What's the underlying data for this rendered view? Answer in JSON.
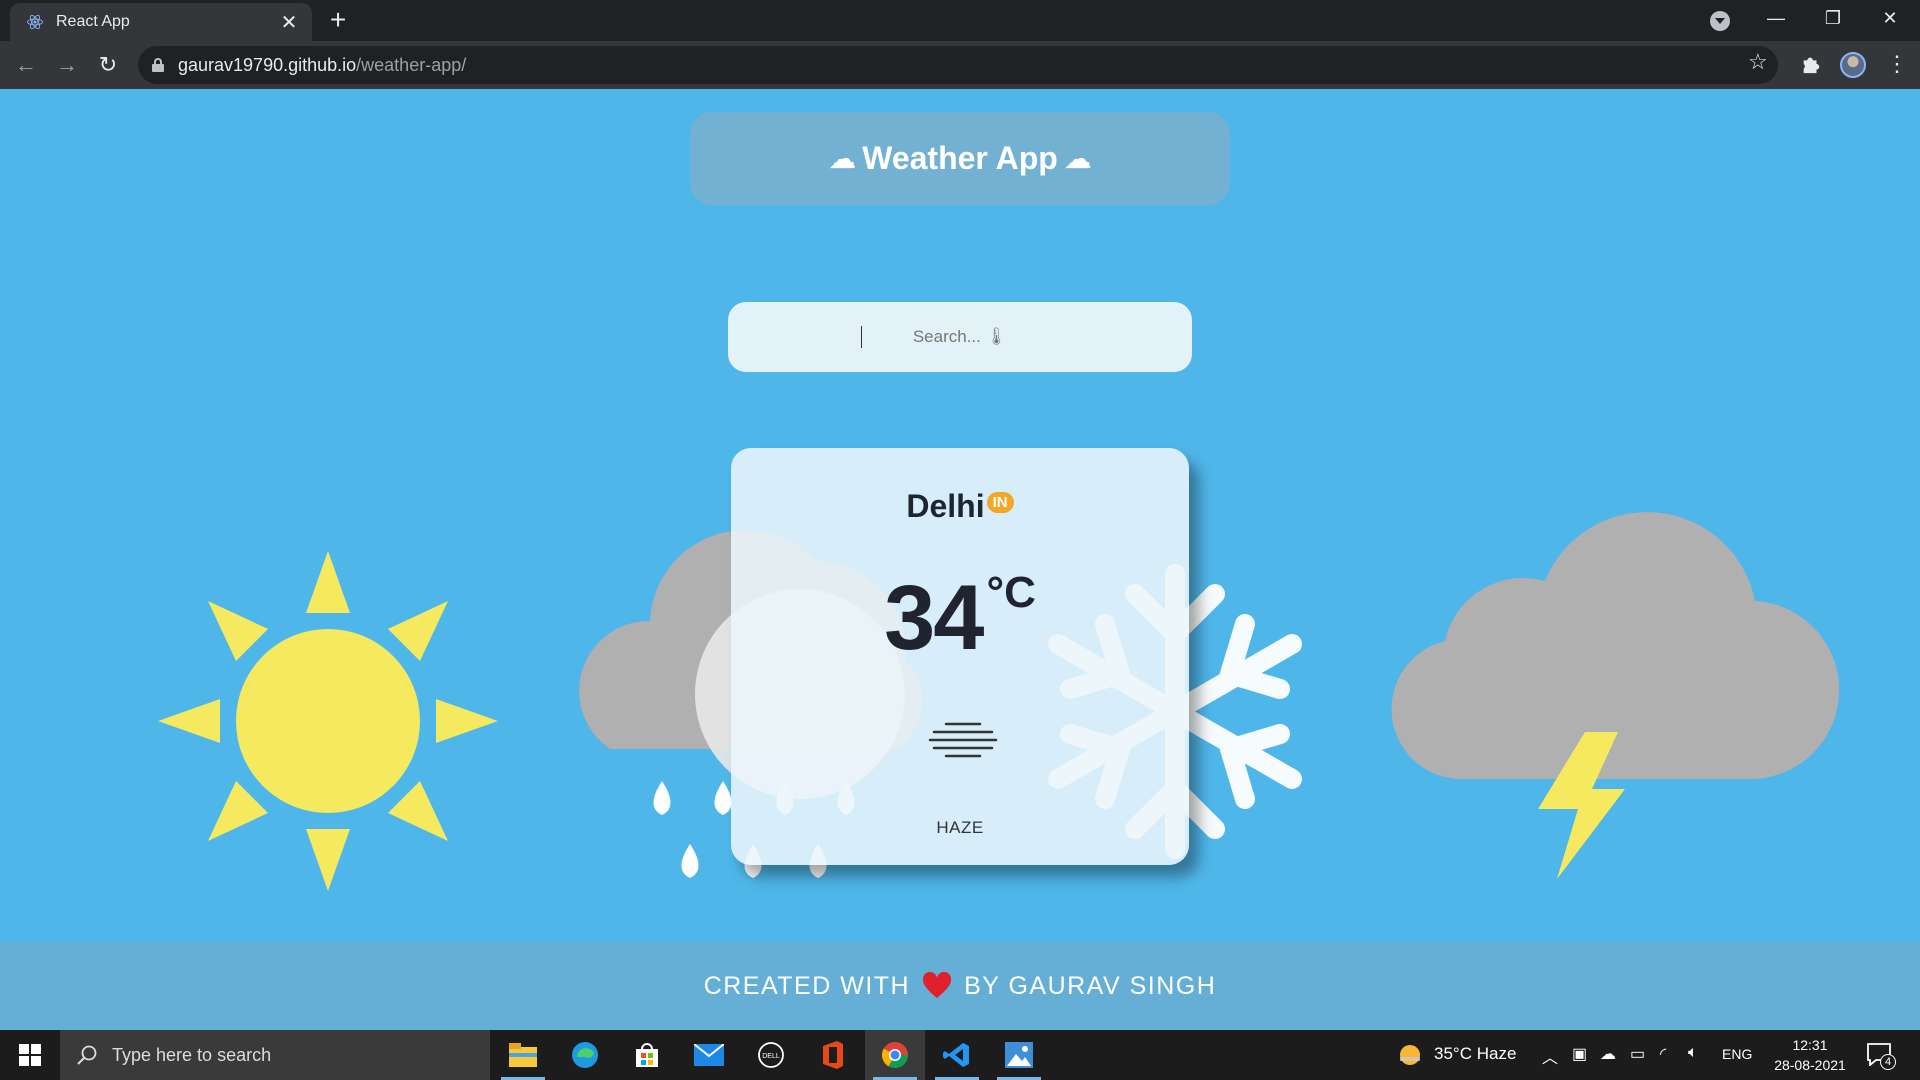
{
  "browser": {
    "tab_title": "React App",
    "url_host": "gaurav19790.github.io",
    "url_path": "/weather-app/",
    "icons": [
      "react-icon",
      "close-icon",
      "plus-icon",
      "back-icon",
      "forward-icon",
      "reload-icon",
      "lock-icon",
      "star-icon",
      "puzzle-icon",
      "menu-icon"
    ]
  },
  "app": {
    "title": "Weather App",
    "search_placeholder": "Search... 🌡",
    "card": {
      "city": "Delhi",
      "country": "IN",
      "temp": "34",
      "unit": "°C",
      "condition": "HAZE"
    },
    "footer_left": "CREATED WITH",
    "footer_right": "BY GAURAV SINGH",
    "colors": {
      "background": "#4fb6e9",
      "sun": "#f5e960",
      "cloud": "#b0b0b0",
      "badge": "#f5a623",
      "heart": "#e0202a"
    }
  },
  "taskbar": {
    "search_placeholder": "Type here to search",
    "weather": "35°C  Haze",
    "language": "ENG",
    "time": "12:31",
    "date": "28-08-2021",
    "notification_count": "4"
  }
}
